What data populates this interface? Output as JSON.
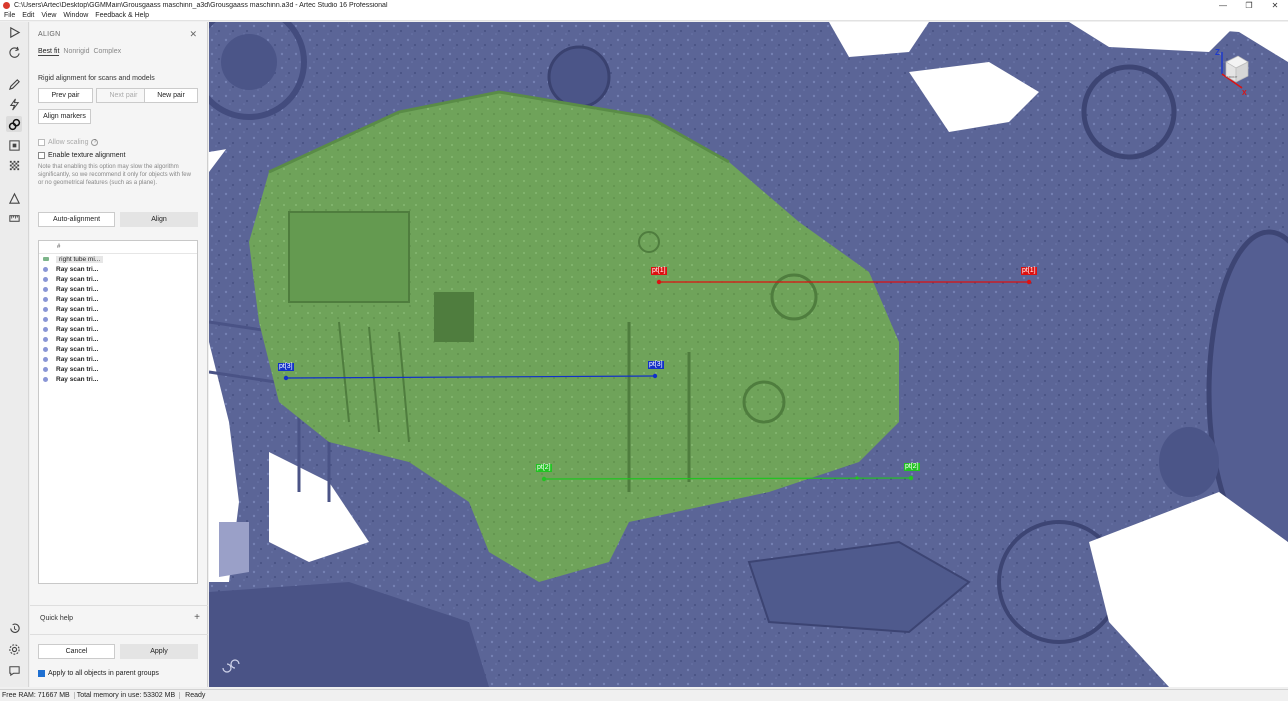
{
  "window": {
    "title": "C:\\Users\\Artec\\Desktop\\GGMMain\\Grousgaass maschinn_a3d\\Grousgaass maschinn.a3d - Artec Studio 16 Professional",
    "minimize": "—",
    "maximize": "❐",
    "close": "✕"
  },
  "menu": [
    "File",
    "Edit",
    "View",
    "Window",
    "Feedback & Help"
  ],
  "panel": {
    "title": "ALIGN",
    "close": "✕",
    "tabs": [
      "Best fit",
      "Nonrigid",
      "Complex"
    ],
    "description": "Rigid alignment for scans and models",
    "prev_pair": "Prev pair",
    "next_pair": "Next pair",
    "new_pair": "New pair",
    "align_markers": "Align markers",
    "allow_scaling": "Allow scaling",
    "enable_texture": "Enable texture alignment",
    "note": "Note that enabling this option may slow the algorithm significantly, so we recommend it only for objects with few or no geometrical features (such as a plane).",
    "auto_alignment": "Auto-alignment",
    "align": "Align",
    "list_header": "#",
    "group_item": "right tube mi...",
    "scan_items": [
      "Ray scan tri...",
      "Ray scan tri...",
      "Ray scan tri...",
      "Ray scan tri...",
      "Ray scan tri...",
      "Ray scan tri...",
      "Ray scan tri...",
      "Ray scan tri...",
      "Ray scan tri...",
      "Ray scan tri...",
      "Ray scan tri...",
      "Ray scan tri..."
    ],
    "quick_help": "Quick help",
    "quick_help_plus": "+",
    "cancel": "Cancel",
    "apply": "Apply",
    "apply_all": "Apply to all objects in parent groups"
  },
  "markers": {
    "red": "pt[1]",
    "blue": "pt[3]",
    "green": "pt[2]"
  },
  "cube": {
    "z": "Z",
    "x": "X",
    "face": "FRONT"
  },
  "status": {
    "free_ram": "Free RAM: 71667 MB",
    "total_memory": "Total memory in use: 53302 MB",
    "state": "Ready"
  },
  "colors": {
    "scan_blue": "#5b6597",
    "model_green": "#6fa35a",
    "marker_red": "#dd1111",
    "marker_blue": "#1230c8",
    "marker_green": "#23c323",
    "accent": "#1e6fd1"
  }
}
